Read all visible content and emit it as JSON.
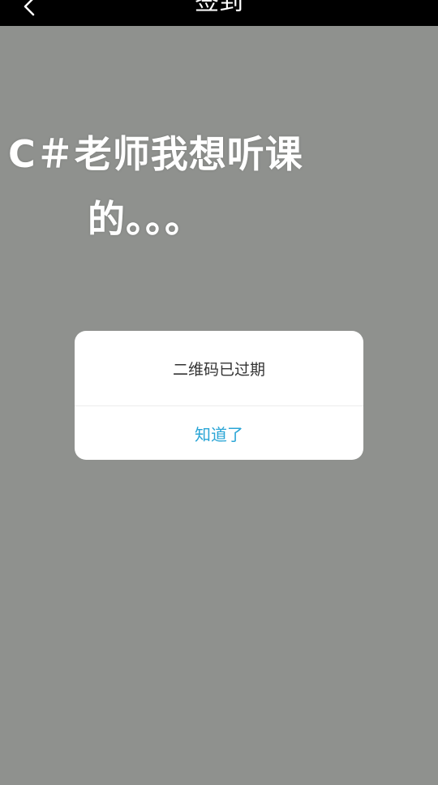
{
  "nav": {
    "title": "签到",
    "back_icon": "chevron-left-icon"
  },
  "overlay": {
    "line1": "C＃老师我想听课",
    "line2": "的。。。"
  },
  "dialog": {
    "message": "二维码已过期",
    "confirm_label": "知道了"
  },
  "colors": {
    "background": "#8f918e",
    "topbar": "#000000",
    "accent": "#2aa5d6",
    "dialog_bg": "#ffffff",
    "message_text": "#333333"
  }
}
